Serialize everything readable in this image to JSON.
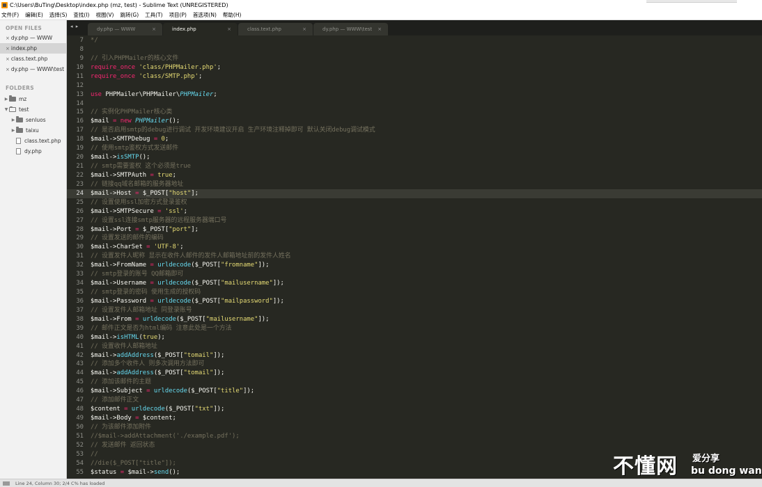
{
  "window": {
    "title": "C:\\Users\\BuTing\\Desktop\\index.php (mz, test) - Sublime Text (UNREGISTERED)"
  },
  "menu": [
    {
      "label": "文件(F)"
    },
    {
      "label": "编辑(E)"
    },
    {
      "label": "选择(S)"
    },
    {
      "label": "查找(I)"
    },
    {
      "label": "视图(V)"
    },
    {
      "label": "跳转(G)"
    },
    {
      "label": "工具(T)"
    },
    {
      "label": "项目(P)"
    },
    {
      "label": "首选项(N)"
    },
    {
      "label": "帮助(H)"
    }
  ],
  "sidebar": {
    "open_files_header": "OPEN FILES",
    "open_files": [
      {
        "label": "dy.php — WWW",
        "active": false
      },
      {
        "label": "index.php",
        "active": true
      },
      {
        "label": "class.text.php",
        "active": false
      },
      {
        "label": "dy.php — WWW\\test",
        "active": false
      }
    ],
    "folders_header": "FOLDERS",
    "tree": [
      {
        "label": "mz",
        "kind": "folder",
        "depth": 0,
        "expanded": false
      },
      {
        "label": "test",
        "kind": "folder",
        "depth": 0,
        "expanded": true
      },
      {
        "label": "senluos",
        "kind": "folder",
        "depth": 1,
        "expanded": false
      },
      {
        "label": "taixu",
        "kind": "folder",
        "depth": 1,
        "expanded": false
      },
      {
        "label": "class.text.php",
        "kind": "file",
        "depth": 1
      },
      {
        "label": "dy.php",
        "kind": "file",
        "depth": 1
      }
    ]
  },
  "tabs": [
    {
      "label": "dy.php — WWW",
      "active": false
    },
    {
      "label": "index.php",
      "active": true
    },
    {
      "label": "class.text.php",
      "active": false
    },
    {
      "label": "dy.php — WWW\\test",
      "active": false
    }
  ],
  "tab_close_glyph": "×",
  "tab_nav_glyph": "◂ ▸",
  "editor": {
    "current_line": 24,
    "lines": [
      {
        "n": "7",
        "tokens": [
          {
            "t": "*/",
            "c": "comment"
          }
        ]
      },
      {
        "n": "8",
        "tokens": []
      },
      {
        "n": "9",
        "tokens": [
          {
            "t": "// 引入PHPMailer的核心文件",
            "c": "comment"
          }
        ]
      },
      {
        "n": "10",
        "tokens": [
          {
            "t": "require_once",
            "c": "kw"
          },
          {
            "t": " ",
            "c": "plain"
          },
          {
            "t": "'class/PHPMailer.php'",
            "c": "str"
          },
          {
            "t": ";",
            "c": "plain"
          }
        ]
      },
      {
        "n": "11",
        "tokens": [
          {
            "t": "require_once",
            "c": "kw"
          },
          {
            "t": " ",
            "c": "plain"
          },
          {
            "t": "'class/SMTP.php'",
            "c": "str"
          },
          {
            "t": ";",
            "c": "plain"
          }
        ]
      },
      {
        "n": "12",
        "tokens": []
      },
      {
        "n": "13",
        "tokens": [
          {
            "t": "use",
            "c": "kw"
          },
          {
            "t": " PHPMailer\\PHPMailer\\",
            "c": "plain"
          },
          {
            "t": "PHPMailer",
            "c": "cls"
          },
          {
            "t": ";",
            "c": "plain"
          }
        ]
      },
      {
        "n": "14",
        "tokens": []
      },
      {
        "n": "15",
        "tokens": [
          {
            "t": "// 实例化PHPMailer核心类",
            "c": "comment"
          }
        ]
      },
      {
        "n": "16",
        "tokens": [
          {
            "t": "$mail",
            "c": "var"
          },
          {
            "t": " = ",
            "c": "kw"
          },
          {
            "t": "new",
            "c": "kw"
          },
          {
            "t": " ",
            "c": "plain"
          },
          {
            "t": "PHPMailer",
            "c": "cls"
          },
          {
            "t": "();",
            "c": "plain"
          }
        ]
      },
      {
        "n": "17",
        "tokens": [
          {
            "t": "// 是否启用smtp的debug进行调试 开发环境建议开启 生产环境注释掉即可 默认关闭debug调试模式",
            "c": "comment"
          }
        ]
      },
      {
        "n": "18",
        "tokens": [
          {
            "t": "$mail->SMTPDebug",
            "c": "var"
          },
          {
            "t": " = ",
            "c": "kw"
          },
          {
            "t": "0",
            "c": "str"
          },
          {
            "t": ";",
            "c": "plain"
          }
        ]
      },
      {
        "n": "19",
        "tokens": [
          {
            "t": "// 使用smtp鉴权方式发送邮件",
            "c": "comment"
          }
        ]
      },
      {
        "n": "20",
        "tokens": [
          {
            "t": "$mail->",
            "c": "var"
          },
          {
            "t": "isSMTP",
            "c": "fn"
          },
          {
            "t": "();",
            "c": "plain"
          }
        ]
      },
      {
        "n": "21",
        "tokens": [
          {
            "t": "// smtp需要鉴权 这个必须是true",
            "c": "comment"
          }
        ]
      },
      {
        "n": "22",
        "tokens": [
          {
            "t": "$mail->SMTPAuth",
            "c": "var"
          },
          {
            "t": " = ",
            "c": "kw"
          },
          {
            "t": "true",
            "c": "str"
          },
          {
            "t": ";",
            "c": "plain"
          }
        ]
      },
      {
        "n": "23",
        "tokens": [
          {
            "t": "// 链接qq域名邮箱的服务器地址",
            "c": "comment"
          }
        ]
      },
      {
        "n": "24",
        "tokens": [
          {
            "t": "$mail->Host",
            "c": "var"
          },
          {
            "t": " = ",
            "c": "kw"
          },
          {
            "t": "$_POST[",
            "c": "plain"
          },
          {
            "t": "\"host\"",
            "c": "str"
          },
          {
            "t": "];",
            "c": "plain"
          }
        ]
      },
      {
        "n": "25",
        "tokens": [
          {
            "t": "// 设置使用ssl加密方式登录鉴权",
            "c": "comment"
          }
        ]
      },
      {
        "n": "26",
        "tokens": [
          {
            "t": "$mail->SMTPSecure",
            "c": "var"
          },
          {
            "t": " = ",
            "c": "kw"
          },
          {
            "t": "'ssl'",
            "c": "str"
          },
          {
            "t": ";",
            "c": "plain"
          }
        ]
      },
      {
        "n": "27",
        "tokens": [
          {
            "t": "// 设置ssl连接smtp服务器的远程服务器端口号",
            "c": "comment"
          }
        ]
      },
      {
        "n": "28",
        "tokens": [
          {
            "t": "$mail->Port",
            "c": "var"
          },
          {
            "t": " = ",
            "c": "kw"
          },
          {
            "t": "$_POST[",
            "c": "plain"
          },
          {
            "t": "\"port\"",
            "c": "str"
          },
          {
            "t": "];",
            "c": "plain"
          }
        ]
      },
      {
        "n": "29",
        "tokens": [
          {
            "t": "// 设置发送的邮件的编码",
            "c": "comment"
          }
        ]
      },
      {
        "n": "30",
        "tokens": [
          {
            "t": "$mail->CharSet",
            "c": "var"
          },
          {
            "t": " = ",
            "c": "kw"
          },
          {
            "t": "'UTF-8'",
            "c": "str"
          },
          {
            "t": ";",
            "c": "plain"
          }
        ]
      },
      {
        "n": "31",
        "tokens": [
          {
            "t": "// 设置发件人昵称 显示在收件人邮件的发件人邮箱地址前的发件人姓名",
            "c": "comment"
          }
        ]
      },
      {
        "n": "32",
        "tokens": [
          {
            "t": "$mail->FromName",
            "c": "var"
          },
          {
            "t": " = ",
            "c": "kw"
          },
          {
            "t": "urldecode",
            "c": "fn"
          },
          {
            "t": "($_POST[",
            "c": "plain"
          },
          {
            "t": "\"fromname\"",
            "c": "str"
          },
          {
            "t": "]);",
            "c": "plain"
          }
        ]
      },
      {
        "n": "33",
        "tokens": [
          {
            "t": "// smtp登录的账号 QQ邮箱即可",
            "c": "comment"
          }
        ]
      },
      {
        "n": "34",
        "tokens": [
          {
            "t": "$mail->Username",
            "c": "var"
          },
          {
            "t": " = ",
            "c": "kw"
          },
          {
            "t": "urldecode",
            "c": "fn"
          },
          {
            "t": "($_POST[",
            "c": "plain"
          },
          {
            "t": "\"mailusername\"",
            "c": "str"
          },
          {
            "t": "]);",
            "c": "plain"
          }
        ]
      },
      {
        "n": "35",
        "tokens": [
          {
            "t": "// smtp登录的密码 使用生成的授权码",
            "c": "comment"
          }
        ]
      },
      {
        "n": "36",
        "tokens": [
          {
            "t": "$mail->Password",
            "c": "var"
          },
          {
            "t": " = ",
            "c": "kw"
          },
          {
            "t": "urldecode",
            "c": "fn"
          },
          {
            "t": "($_POST[",
            "c": "plain"
          },
          {
            "t": "\"mailpassword\"",
            "c": "str"
          },
          {
            "t": "]);",
            "c": "plain"
          }
        ]
      },
      {
        "n": "37",
        "tokens": [
          {
            "t": "// 设置发件人邮箱地址 同登录账号",
            "c": "comment"
          }
        ]
      },
      {
        "n": "38",
        "tokens": [
          {
            "t": "$mail->From",
            "c": "var"
          },
          {
            "t": " = ",
            "c": "kw"
          },
          {
            "t": "urldecode",
            "c": "fn"
          },
          {
            "t": "($_POST[",
            "c": "plain"
          },
          {
            "t": "\"mailusername\"",
            "c": "str"
          },
          {
            "t": "]);",
            "c": "plain"
          }
        ]
      },
      {
        "n": "39",
        "tokens": [
          {
            "t": "// 邮件正文是否为html编码 注意此处是一个方法",
            "c": "comment"
          }
        ]
      },
      {
        "n": "40",
        "tokens": [
          {
            "t": "$mail->",
            "c": "var"
          },
          {
            "t": "isHTML",
            "c": "fn"
          },
          {
            "t": "(",
            "c": "plain"
          },
          {
            "t": "true",
            "c": "str"
          },
          {
            "t": ");",
            "c": "plain"
          }
        ]
      },
      {
        "n": "41",
        "tokens": [
          {
            "t": "// 设置收件人邮箱地址",
            "c": "comment"
          }
        ]
      },
      {
        "n": "42",
        "tokens": [
          {
            "t": "$mail->",
            "c": "var"
          },
          {
            "t": "addAddress",
            "c": "fn"
          },
          {
            "t": "($_POST[",
            "c": "plain"
          },
          {
            "t": "\"tomail\"",
            "c": "str"
          },
          {
            "t": "]);",
            "c": "plain"
          }
        ]
      },
      {
        "n": "43",
        "tokens": [
          {
            "t": "// 添加多个收件人 则多次调用方法即可",
            "c": "comment"
          }
        ]
      },
      {
        "n": "44",
        "tokens": [
          {
            "t": "$mail->",
            "c": "var"
          },
          {
            "t": "addAddress",
            "c": "fn"
          },
          {
            "t": "($_POST[",
            "c": "plain"
          },
          {
            "t": "\"tomail\"",
            "c": "str"
          },
          {
            "t": "]);",
            "c": "plain"
          }
        ]
      },
      {
        "n": "45",
        "tokens": [
          {
            "t": "// 添加该邮件的主题",
            "c": "comment"
          }
        ]
      },
      {
        "n": "46",
        "tokens": [
          {
            "t": "$mail->Subject",
            "c": "var"
          },
          {
            "t": " = ",
            "c": "kw"
          },
          {
            "t": "urldecode",
            "c": "fn"
          },
          {
            "t": "($_POST[",
            "c": "plain"
          },
          {
            "t": "\"title\"",
            "c": "str"
          },
          {
            "t": "]);",
            "c": "plain"
          }
        ]
      },
      {
        "n": "47",
        "tokens": [
          {
            "t": "// 添加邮件正文",
            "c": "comment"
          }
        ]
      },
      {
        "n": "48",
        "tokens": [
          {
            "t": "$content",
            "c": "var"
          },
          {
            "t": " = ",
            "c": "kw"
          },
          {
            "t": "urldecode",
            "c": "fn"
          },
          {
            "t": "($_POST[",
            "c": "plain"
          },
          {
            "t": "\"txt\"",
            "c": "str"
          },
          {
            "t": "]);",
            "c": "plain"
          }
        ]
      },
      {
        "n": "49",
        "tokens": [
          {
            "t": "$mail->Body",
            "c": "var"
          },
          {
            "t": " = ",
            "c": "kw"
          },
          {
            "t": "$content;",
            "c": "plain"
          }
        ]
      },
      {
        "n": "50",
        "tokens": [
          {
            "t": "// 为该邮件添加附件",
            "c": "comment"
          }
        ]
      },
      {
        "n": "51",
        "tokens": [
          {
            "t": "//$mail->addAttachment('./example.pdf');",
            "c": "comment"
          }
        ]
      },
      {
        "n": "52",
        "tokens": [
          {
            "t": "// 发送邮件 返回状态",
            "c": "comment"
          }
        ]
      },
      {
        "n": "53",
        "tokens": [
          {
            "t": "//",
            "c": "comment"
          }
        ]
      },
      {
        "n": "54",
        "tokens": [
          {
            "t": "//die($_POST[\"title\"]);",
            "c": "comment"
          }
        ]
      },
      {
        "n": "55",
        "tokens": [
          {
            "t": "$status",
            "c": "var"
          },
          {
            "t": " = ",
            "c": "kw"
          },
          {
            "t": "$mail->",
            "c": "plain"
          },
          {
            "t": "send",
            "c": "fn"
          },
          {
            "t": "();",
            "c": "plain"
          }
        ]
      }
    ]
  },
  "status": {
    "text": "Line 24, Column 30; 2/4 C% has loaded"
  },
  "watermark": {
    "main": "不懂网",
    "sub": "爱分享",
    "roman": "bu dong wang"
  },
  "colors": {
    "editor_bg": "#272822",
    "comment": "#75715e",
    "keyword": "#f92672",
    "string": "#e6db74",
    "function": "#66d9ef"
  }
}
